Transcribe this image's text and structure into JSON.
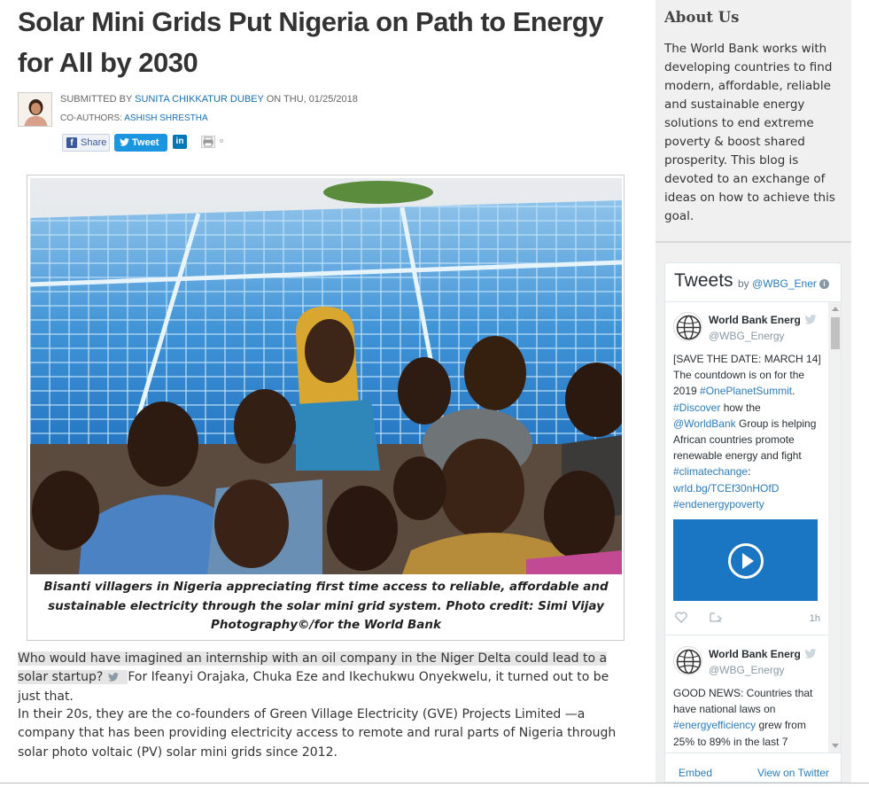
{
  "article": {
    "title": "Solar Mini Grids Put Nigeria on Path to Energy for All by 2030",
    "submitted_label": "SUBMITTED BY",
    "author": "SUNITA CHIKKATUR DUBEY",
    "date_prefix": "ON THU,",
    "date": "01/25/2018",
    "coauthors_label": "CO-AUTHORS:",
    "coauthor": "ASHISH SHRESTHA",
    "caption": "Bisanti villagers in Nigeria appreciating first time access to reliable, affordable and sustainable electricity through the solar mini grid system. Photo credit: Simi Vijay Photography©/for the World Bank",
    "para1_highlight": "Who would have imagined an internship with an oil company in the Niger Delta could lead to a solar startup?",
    "para1_rest": "For Ifeanyi Orajaka, Chuka Eze and Ikechukwu Onyekwelu, it turned out to be just that.",
    "para2": "In their 20s, they are the co-founders of Green Village Electricity (GVE) Projects Limited —a company that has been providing electricity access to remote and rural parts of Nigeria through solar photo voltaic (PV) solar mini grids since 2012."
  },
  "share": {
    "facebook_label": "Share",
    "twitter_label": "Tweet",
    "linkedin_label": "in"
  },
  "sidebar": {
    "about_title": "About Us",
    "about_text": "The World Bank works with developing countries to find modern, affordable, reliable and sustainable energy solutions to end extreme poverty & boost shared prosperity. This blog is devoted to an exchange of ideas on how to achieve this goal."
  },
  "twitter_widget": {
    "title": "Tweets",
    "by_label": "by",
    "account": "@WBG_Ener",
    "info_glyph": "i",
    "embed_label": "Embed",
    "view_label": "View on Twitter",
    "tweets": [
      {
        "name": "World Bank Energ",
        "handle": "@WBG_Energy",
        "text_parts": [
          {
            "t": "[SAVE THE DATE: MARCH 14] The countdown is on for the 2019 ",
            "tag": false
          },
          {
            "t": "#OnePlanetSummit",
            "tag": true
          },
          {
            "t": ". ",
            "tag": false
          },
          {
            "t": "#Discover",
            "tag": true
          },
          {
            "t": " how the ",
            "tag": false
          },
          {
            "t": "@WorldBank",
            "tag": true
          },
          {
            "t": " Group is helping African countries promote renewable energy and fight ",
            "tag": false
          },
          {
            "t": "#climatechange",
            "tag": true
          },
          {
            "t": ": ",
            "tag": false
          },
          {
            "t": "wrld.bg/TCEf30nHOfD",
            "tag": true
          },
          {
            "t": " ",
            "tag": false
          },
          {
            "t": "#endenergypoverty",
            "tag": true
          }
        ],
        "time": "1h"
      },
      {
        "name": "World Bank Energ",
        "handle": "@WBG_Energy",
        "text_parts": [
          {
            "t": "GOOD NEWS: Countries that have national laws on ",
            "tag": false
          },
          {
            "t": "#energyefficiency",
            "tag": true
          },
          {
            "t": " grew from 25% to 89% in the last 7",
            "tag": false
          }
        ]
      }
    ]
  },
  "colors": {
    "link": "#1a6faf",
    "twitter_blue": "#1b95e0",
    "facebook_blue": "#3b5998",
    "linkedin_blue": "#0077b5",
    "sidebar_bg": "#f0f0f0",
    "video_bg": "#1a75c2"
  },
  "icons": {
    "facebook": "facebook-icon",
    "twitter": "twitter-bird-icon",
    "linkedin": "linkedin-icon",
    "print": "printer-icon",
    "play": "play-icon",
    "like": "heart-icon",
    "retweet": "share-icon",
    "info": "info-icon"
  }
}
